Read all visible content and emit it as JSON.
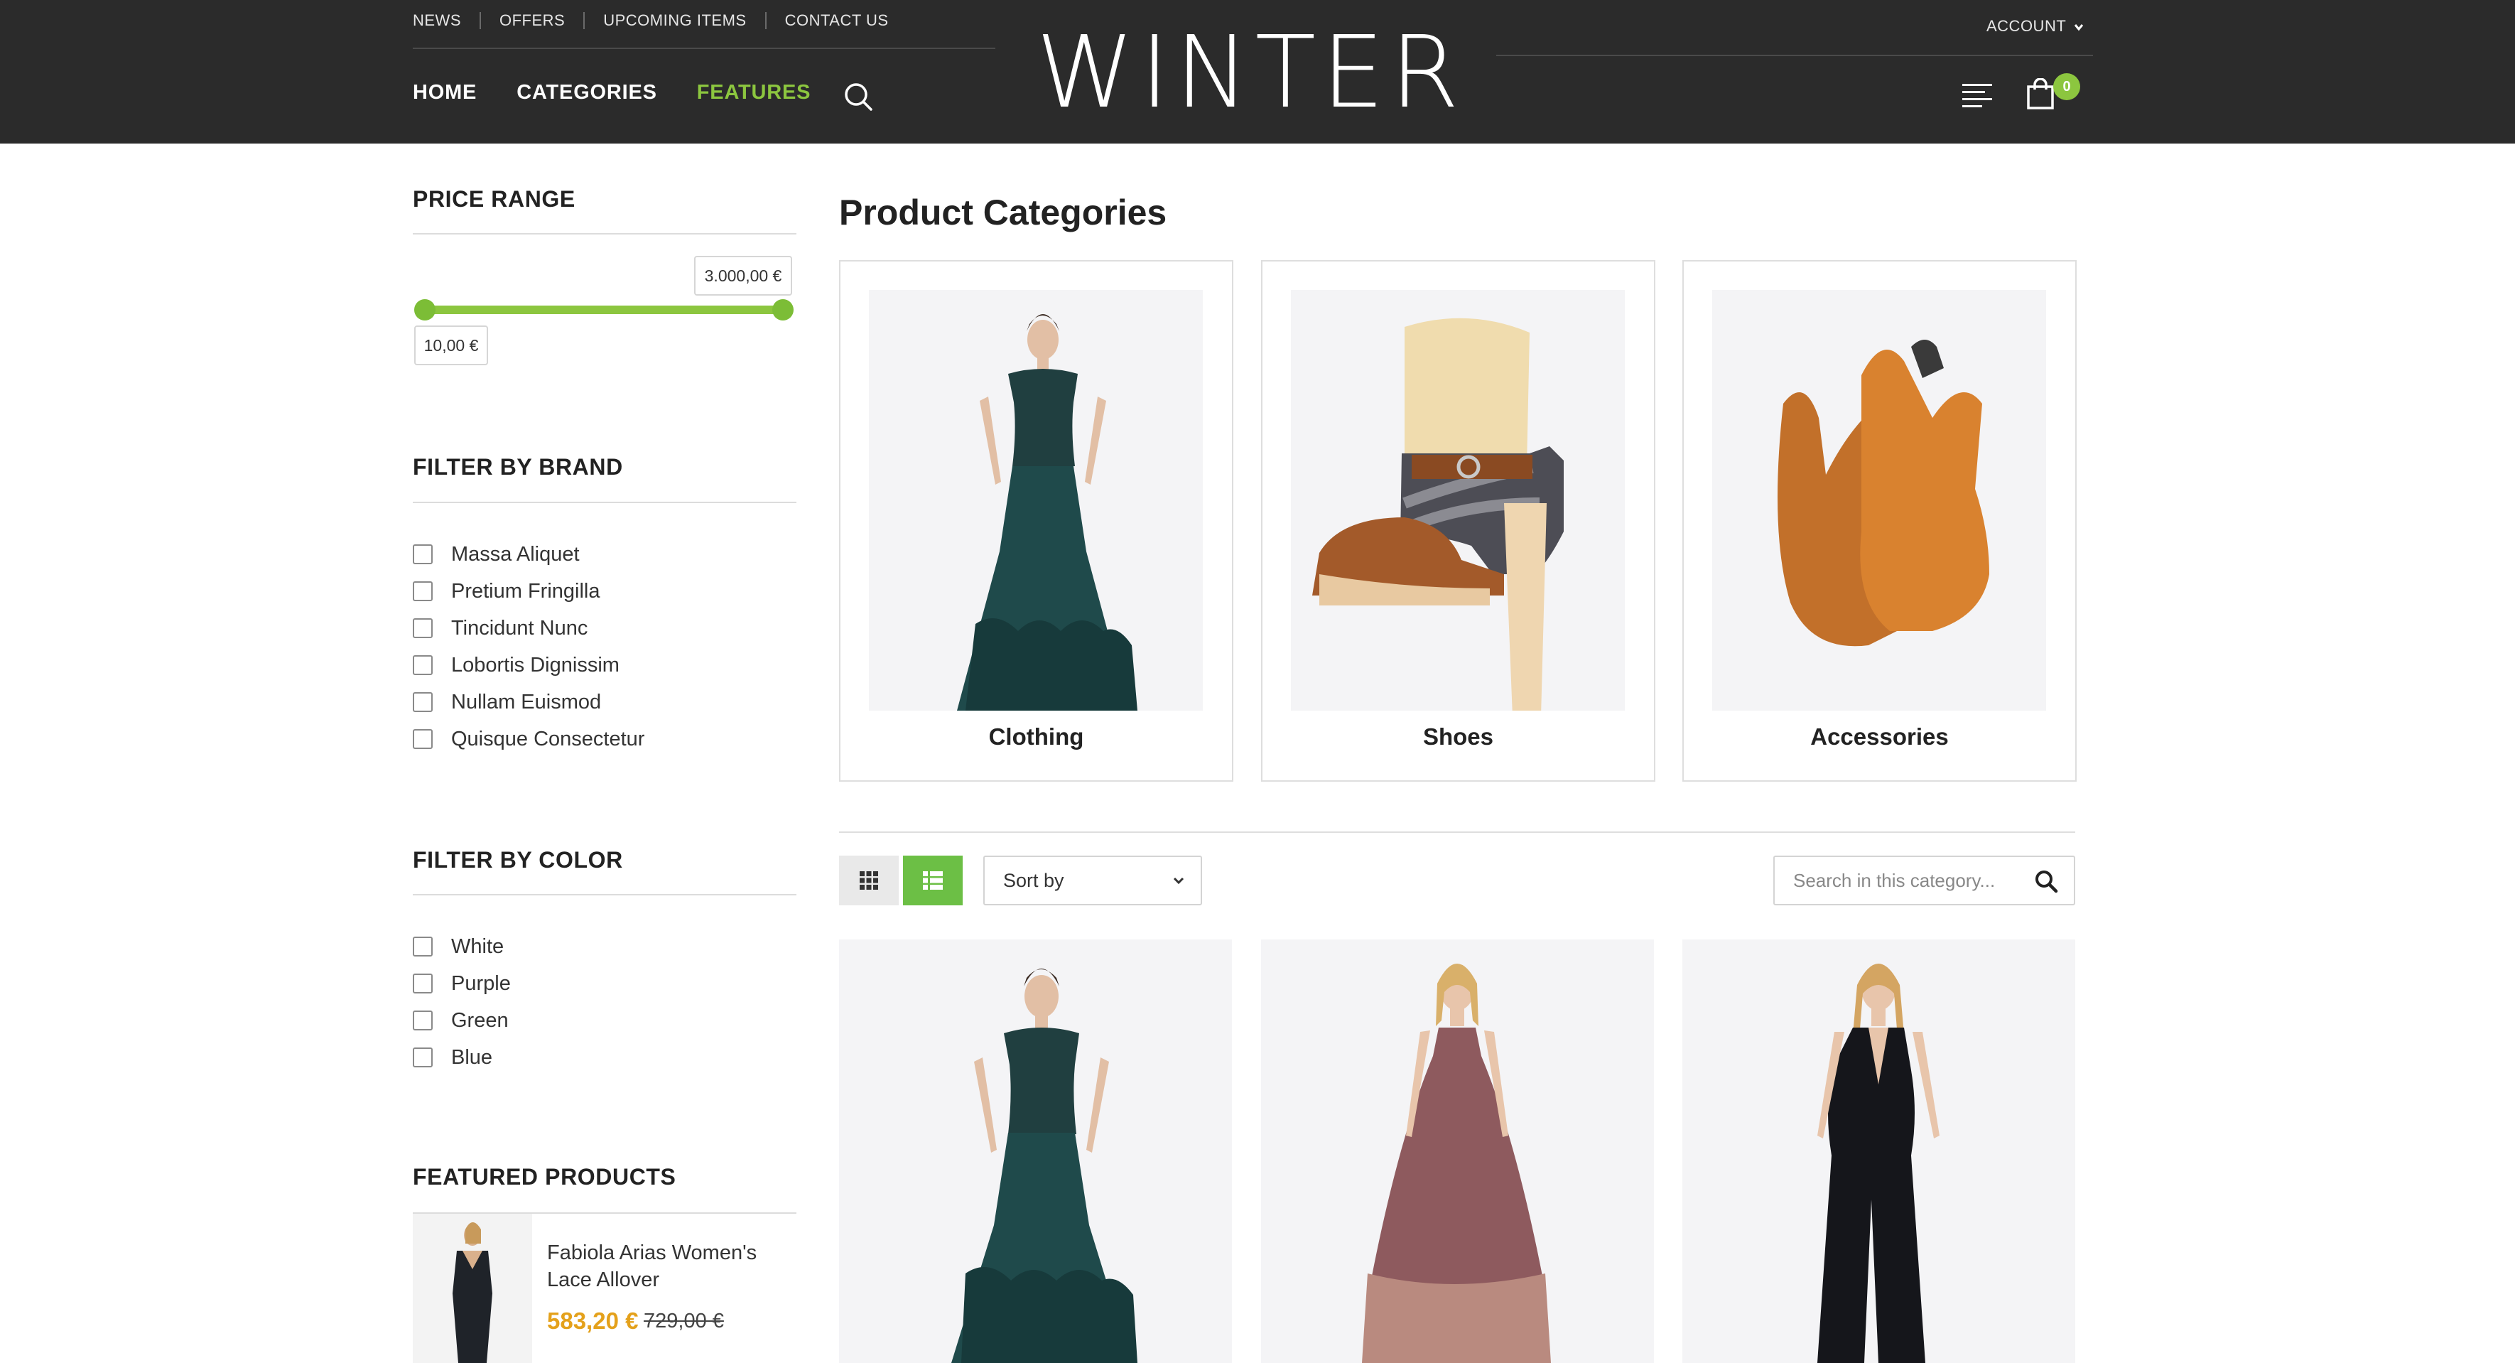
{
  "header": {
    "top_links": [
      "NEWS",
      "OFFERS",
      "UPCOMING ITEMS",
      "CONTACT US"
    ],
    "nav": [
      {
        "label": "HOME",
        "active": false
      },
      {
        "label": "CATEGORIES",
        "active": false
      },
      {
        "label": "FEATURES",
        "active": true
      }
    ],
    "logo": "WINTER",
    "account_label": "ACCOUNT",
    "cart_count": "0",
    "icons": [
      "search-icon",
      "menu-icon",
      "shopping-bag-icon",
      "chevron-down-icon"
    ],
    "accent_color": "#8cc63f"
  },
  "sidebar": {
    "price_range": {
      "title": "PRICE RANGE",
      "max": "3.000,00 €",
      "min": "10,00 €"
    },
    "brand": {
      "title": "FILTER BY BRAND",
      "items": [
        "Massa Aliquet",
        "Pretium Fringilla",
        "Tincidunt Nunc",
        "Lobortis Dignissim",
        "Nullam Euismod",
        "Quisque Consectetur"
      ]
    },
    "color": {
      "title": "FILTER BY COLOR",
      "items": [
        "White",
        "Purple",
        "Green",
        "Blue"
      ]
    },
    "featured": {
      "title": "FEATURED PRODUCTS",
      "product_name": "Fabiola Arias Women's Lace Allover",
      "price": "583,20 €",
      "old_price": "729,00 €"
    }
  },
  "main": {
    "title": "Product Categories",
    "categories": [
      {
        "label": "Clothing"
      },
      {
        "label": "Shoes"
      },
      {
        "label": "Accessories"
      }
    ],
    "toolbar": {
      "sort_label": "Sort by",
      "search_placeholder": "Search in this category..."
    }
  }
}
